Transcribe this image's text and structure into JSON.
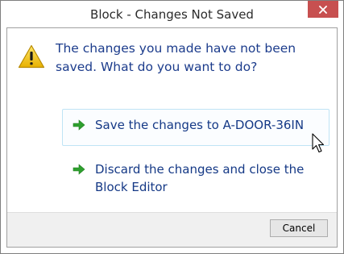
{
  "window": {
    "title": "Block - Changes Not Saved",
    "close_icon": "close-icon",
    "close_color": "#c75050"
  },
  "main": {
    "warning_icon": "warning-icon",
    "instruction": "The changes you made have not been saved. What do you want to do?",
    "options": [
      {
        "label": "Save the changes to A-DOOR-36IN",
        "icon": "green-arrow-icon",
        "hovered": true
      },
      {
        "label": "Discard the changes and close the Block Editor",
        "icon": "green-arrow-icon",
        "hovered": false
      }
    ]
  },
  "footer": {
    "cancel_label": "Cancel"
  },
  "colors": {
    "instruction_text": "#1c3c8c",
    "link_text": "#153986",
    "arrow": "#2fa02f",
    "hover_border": "#bfe4f5"
  }
}
